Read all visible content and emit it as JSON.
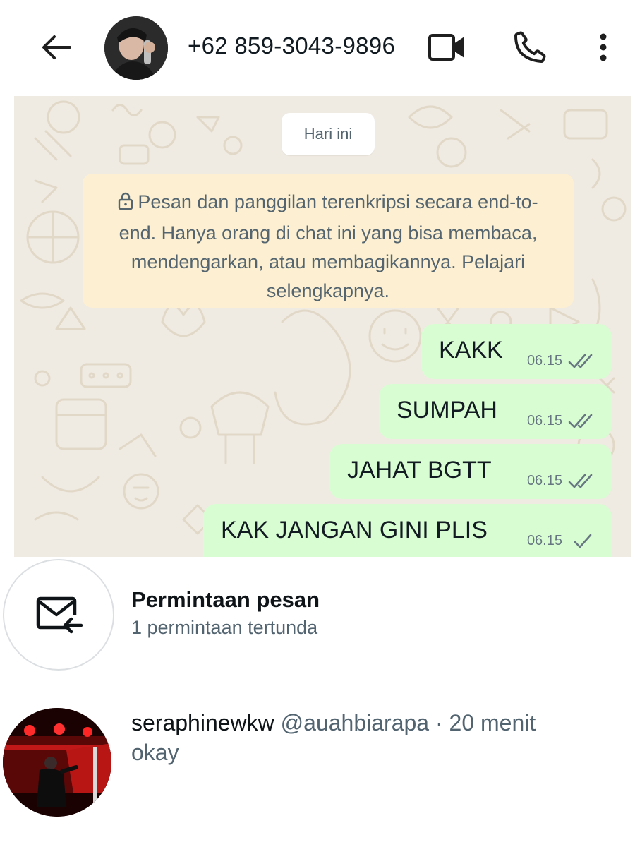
{
  "header": {
    "contact": "+62 859-3043-9896",
    "icons": [
      "back-arrow-icon",
      "video-call-icon",
      "phone-call-icon",
      "more-vertical-icon"
    ]
  },
  "chat": {
    "date_chip": "Hari ini",
    "encryption_notice": "Pesan dan panggilan terenkripsi secara end-to-end. Hanya orang di chat ini yang bisa membaca, mendengarkan, atau membagikannya. Pelajari selengkapnya.",
    "messages": [
      {
        "text": "KAKK",
        "time": "06.15",
        "status": "read"
      },
      {
        "text": "SUMPAH",
        "time": "06.15",
        "status": "read"
      },
      {
        "text": "JAHAT BGTT",
        "time": "06.15",
        "status": "read"
      },
      {
        "text": "KAK JANGAN GINI PLIS",
        "time": "06.15",
        "status": "sent"
      }
    ],
    "colors": {
      "background": "#efeae2",
      "outgoing_bubble": "#d9fdd3",
      "notice": "#fdf0d2",
      "tick": "#667781"
    }
  },
  "requests": {
    "title": "Permintaan pesan",
    "subtitle": "1 permintaan tertunda",
    "icon": "mail-incoming-icon"
  },
  "conversation": {
    "name": "seraphinewkw",
    "handle": "@auahbiarapa",
    "separator": "·",
    "time_ago": "20 menit",
    "last_message": "okay"
  }
}
